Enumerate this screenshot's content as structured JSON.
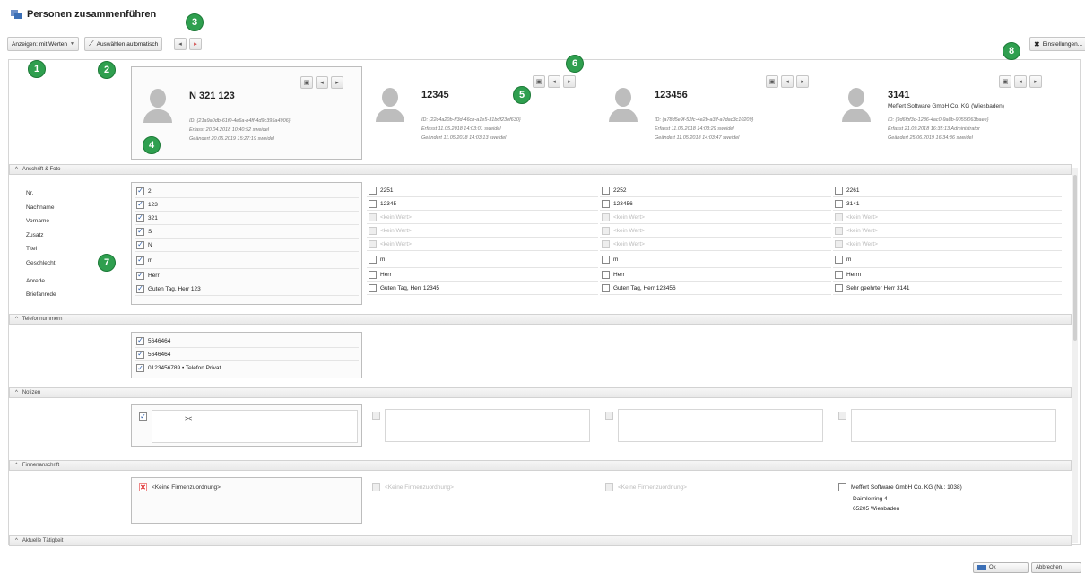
{
  "window": {
    "title": "Personen zusammenführen"
  },
  "toolbar": {
    "show_label": "Anzeigen: mit Werten",
    "auto_select_label": "Auswählen automatisch",
    "settings_label": "Einstellungen..."
  },
  "annotations": [
    "1",
    "2",
    "3",
    "4",
    "5",
    "6",
    "7",
    "8"
  ],
  "cards": [
    {
      "name": "N 321 123",
      "sub": "",
      "id": "ID: {21a9a0db-61f0-4e6a-b4ff-4d9c395a4906}",
      "created": "Erfasst 20.04.2018 10:40:52 sweidel",
      "changed": "Geändert 20.05.2019 15:27:19 sweidel"
    },
    {
      "name": "12345",
      "sub": "",
      "id": "ID: {22c4a20b-ff3d-46cb-a1e5-31bdf23ef630}",
      "created": "Erfasst 11.05.2018 14:03:01 sweidel",
      "changed": "Geändert 11.05.2018 14:03:13 sweidel"
    },
    {
      "name": "123456",
      "sub": "",
      "id": "ID: {a78d5e9f-52fc-4e2b-a3ff-a7dac3c10209}",
      "created": "Erfasst 11.05.2018 14:03:29 sweidel",
      "changed": "Geändert 11.05.2018 14:03:47 sweidel"
    },
    {
      "name": "3141",
      "sub": "Meffert Software GmbH  Co. KG (Wiesbaden)",
      "id": "ID: {9d6fbf3d-1236-4ac0-9a8b-9055f063baee}",
      "created": "Erfasst 21.09.2018 16:35:13 Administrator",
      "changed": "Geändert 25.06.2019 16:34:36 sweidel"
    }
  ],
  "sections": {
    "anschrift": "Anschrift & Foto",
    "telefon": "Telefonnummern",
    "notizen": "Notizen",
    "firma": "Firmenanschrift",
    "taetigkeit": "Aktuelle Tätigkeit"
  },
  "field_labels": [
    "Nr.",
    "Nachname",
    "Vorname",
    "Zusatz",
    "Titel",
    "Geschlecht",
    "Anrede",
    "Briefanrede"
  ],
  "columns": [
    {
      "values": [
        "2",
        "123",
        "321",
        "S",
        "N",
        "m",
        "Herr",
        "Guten Tag,  Herr 123"
      ]
    },
    {
      "values": [
        "2251",
        "12345",
        "<kein Wert>",
        "<kein Wert>",
        "<kein Wert>",
        "m",
        "Herr",
        "Guten Tag,  Herr 12345"
      ]
    },
    {
      "values": [
        "2252",
        "123456",
        "<kein Wert>",
        "<kein Wert>",
        "<kein Wert>",
        "m",
        "Herr",
        "Guten Tag,  Herr 123456"
      ]
    },
    {
      "values": [
        "2261",
        "3141",
        "<kein Wert>",
        "<kein Wert>",
        "<kein Wert>",
        "m",
        "Herrn",
        "Sehr geehrter Herr 3141"
      ]
    }
  ],
  "phones": [
    "5646464",
    "5646464",
    "0123456789 • Telefon Privat"
  ],
  "notes": {
    "col1": "><"
  },
  "firma": {
    "none": "<Keine Firmenzuordnung>",
    "col4_name": "Meffert Software GmbH  Co. KG (Nr.: 1038)",
    "col4_street": "Daimlerring 4",
    "col4_city": "65205 Wiesbaden"
  },
  "footer": {
    "merge_label": "Ok",
    "cancel_label": "Abbrechen"
  }
}
